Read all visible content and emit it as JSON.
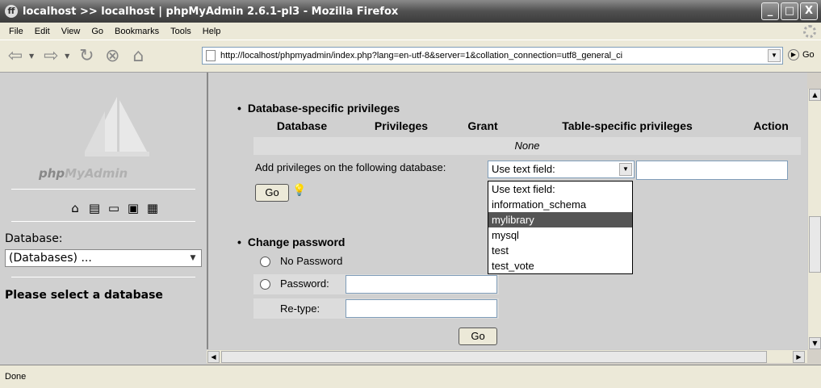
{
  "window": {
    "title": "localhost >> localhost | phpMyAdmin 2.6.1-pl3 - Mozilla Firefox",
    "buttons": [
      "_",
      "□",
      "X"
    ]
  },
  "menu": [
    "File",
    "Edit",
    "View",
    "Go",
    "Bookmarks",
    "Tools",
    "Help"
  ],
  "nav": {
    "url": "http://localhost/phpmyadmin/index.php?lang=en-utf-8&server=1&collation_connection=utf8_general_ci",
    "go_label": "Go"
  },
  "sidebar": {
    "logo_php": "php",
    "logo_myadmin": "MyAdmin",
    "database_label": "Database:",
    "database_select": "(Databases) ...",
    "please_select": "Please select a database"
  },
  "main": {
    "db_section_title": "Database-specific privileges",
    "table_headers": [
      "Database",
      "Privileges",
      "Grant",
      "Table-specific privileges",
      "Action"
    ],
    "none_text": "None",
    "add_priv_label": "Add privileges on the following database:",
    "db_select_value": "Use text field:",
    "go_button": "Go",
    "dropdown_options": [
      "Use text field:",
      "information_schema",
      "mylibrary",
      "mysql",
      "test",
      "test_vote"
    ],
    "dropdown_selected": "mylibrary",
    "pw_section_title": "Change password",
    "no_password": "No Password",
    "password_label": "Password:",
    "retype_label": "Re-type:",
    "pw_go_button": "Go"
  },
  "status": "Done"
}
